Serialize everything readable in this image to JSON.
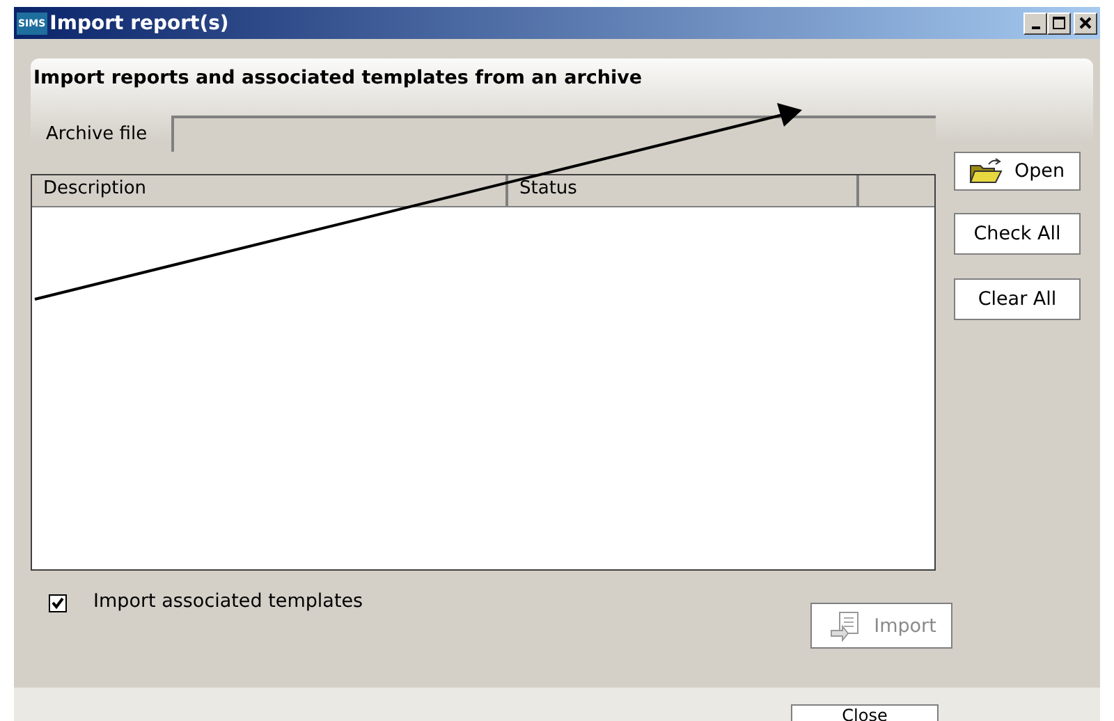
{
  "window": {
    "app_badge": "SIMS",
    "title": "Import report(s)"
  },
  "panel": {
    "heading": "Import reports and associated templates from an archive"
  },
  "archive_field": {
    "label": "Archive file"
  },
  "table": {
    "columns": [
      {
        "label": "Description"
      },
      {
        "label": "Status"
      }
    ]
  },
  "side_buttons": [
    {
      "kind": "open",
      "label": "Open"
    },
    {
      "kind": "plain",
      "label": "Check All"
    },
    {
      "kind": "plain",
      "label": "Clear All"
    }
  ],
  "import_templates": {
    "label": "Import associated templates",
    "checked": true
  },
  "import_button": {
    "label": "Import",
    "disabled": true
  },
  "close_button": {
    "label": "Close"
  }
}
